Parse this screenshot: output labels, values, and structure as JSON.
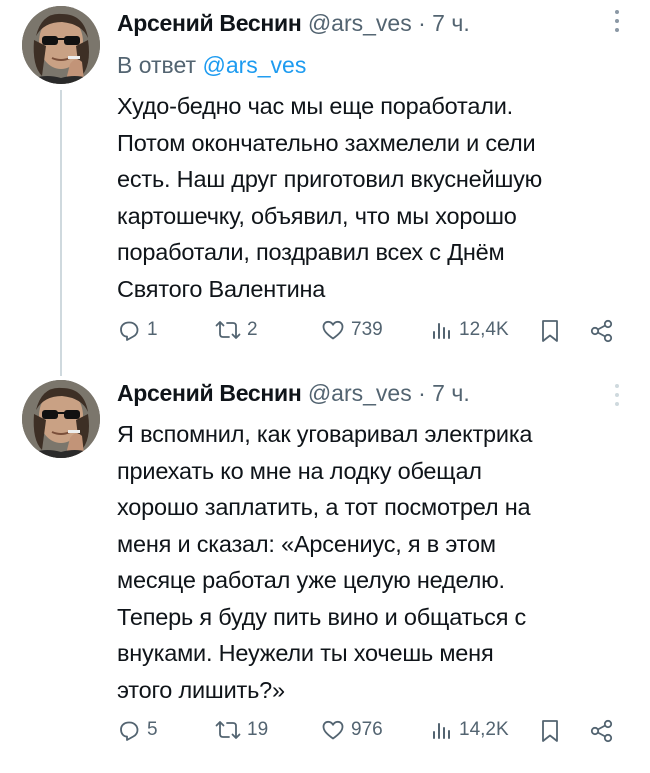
{
  "tweets": [
    {
      "author_name": "Арсений Веснин",
      "handle": "@ars_ves",
      "separator": "·",
      "time": "7 ч.",
      "reply_prefix": "В ответ",
      "reply_mention": "@ars_ves",
      "text_lines": [
        "Худо-бедно час мы еще поработали.",
        "Потом окончательно захмелели и сели",
        "есть. Наш друг приготовил вкуснейшую",
        "картошечку, объявил, что мы хорошо",
        "поработали, поздравил всех с Днём",
        "Святого Валентина"
      ],
      "stats": {
        "replies": "1",
        "retweets": "2",
        "likes": "739",
        "views": "12,4K"
      }
    },
    {
      "author_name": "Арсений Веснин",
      "handle": "@ars_ves",
      "separator": "·",
      "time": "7 ч.",
      "text_lines": [
        "Я вспомнил, как уговаривал электрика",
        "приехать ко мне на лодку обещал",
        "хорошо заплатить, а тот посмотрел на",
        "меня и сказал: «Арсениус, я в этом",
        "месяце работал уже целую неделю.",
        "Теперь я буду пить вино и общаться с",
        "внуками. Неужели ты хочешь меня",
        "этого лишить?»"
      ],
      "stats": {
        "replies": "5",
        "retweets": "19",
        "likes": "976",
        "views": "14,2K"
      }
    }
  ],
  "icons": {
    "reply": "reply-icon",
    "retweet": "retweet-icon",
    "like": "heart-icon",
    "views": "views-icon",
    "bookmark": "bookmark-icon",
    "share": "share-icon",
    "more": "more-icon"
  },
  "colors": {
    "text": "#0f1419",
    "secondary": "#536471",
    "link": "#1d9bf0",
    "thread_line": "#cfd9de"
  }
}
